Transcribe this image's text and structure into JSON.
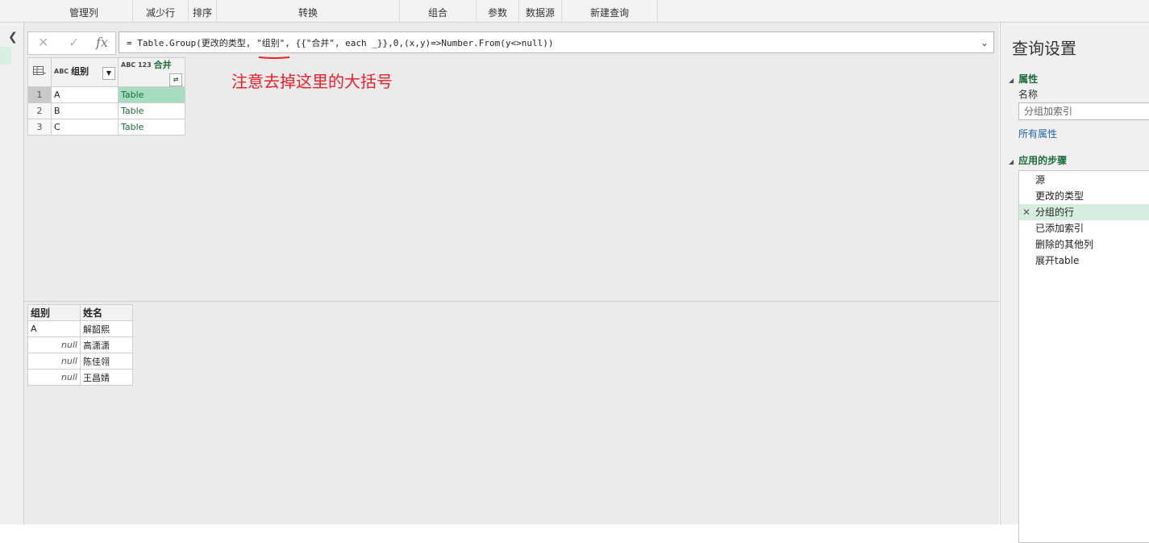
{
  "ribbon": {
    "groups": [
      "管理列",
      "减少行",
      "排序",
      "转换",
      "组合",
      "参数",
      "数据源",
      "新建查询"
    ]
  },
  "formula_bar": {
    "cancel_icon": "✕",
    "commit_icon": "✓",
    "fx_label": "fx",
    "formula": "= Table.Group(更改的类型, \"组别\", {{\"合并\", each _}},0,(x,y)=>Number.From(y<>null))",
    "expand_icon": "chevron-down-icon"
  },
  "annotation": {
    "text": "注意去掉这里的大括号",
    "color": "#e8202a"
  },
  "top_table": {
    "columns": [
      {
        "type_icon": "ABC",
        "name": "组别"
      },
      {
        "type_icon": "ABC 123",
        "name": "合并"
      }
    ],
    "rows": [
      {
        "num": "1",
        "group": "A",
        "merge": "Table"
      },
      {
        "num": "2",
        "group": "B",
        "merge": "Table"
      },
      {
        "num": "3",
        "group": "C",
        "merge": "Table"
      }
    ]
  },
  "bottom_table": {
    "columns": [
      "组别",
      "姓名"
    ],
    "rows": [
      {
        "group": "A",
        "name": "解韶熙"
      },
      {
        "group": "null",
        "name": "高潇潇"
      },
      {
        "group": "null",
        "name": "陈佳翎"
      },
      {
        "group": "null",
        "name": "王昌婧"
      }
    ]
  },
  "query_settings": {
    "title": "查询设置",
    "properties_heading": "属性",
    "name_label": "名称",
    "name_value": "分组加索引",
    "all_properties_link": "所有属性",
    "steps_heading": "应用的步骤",
    "steps": [
      "源",
      "更改的类型",
      "分组的行",
      "已添加索引",
      "删除的其他列",
      "展开table"
    ],
    "active_step_index": 2
  },
  "colors": {
    "accent_green": "#1d6b3d",
    "selected_cell": "#a6dcbf",
    "link_blue": "#1f63a8"
  }
}
